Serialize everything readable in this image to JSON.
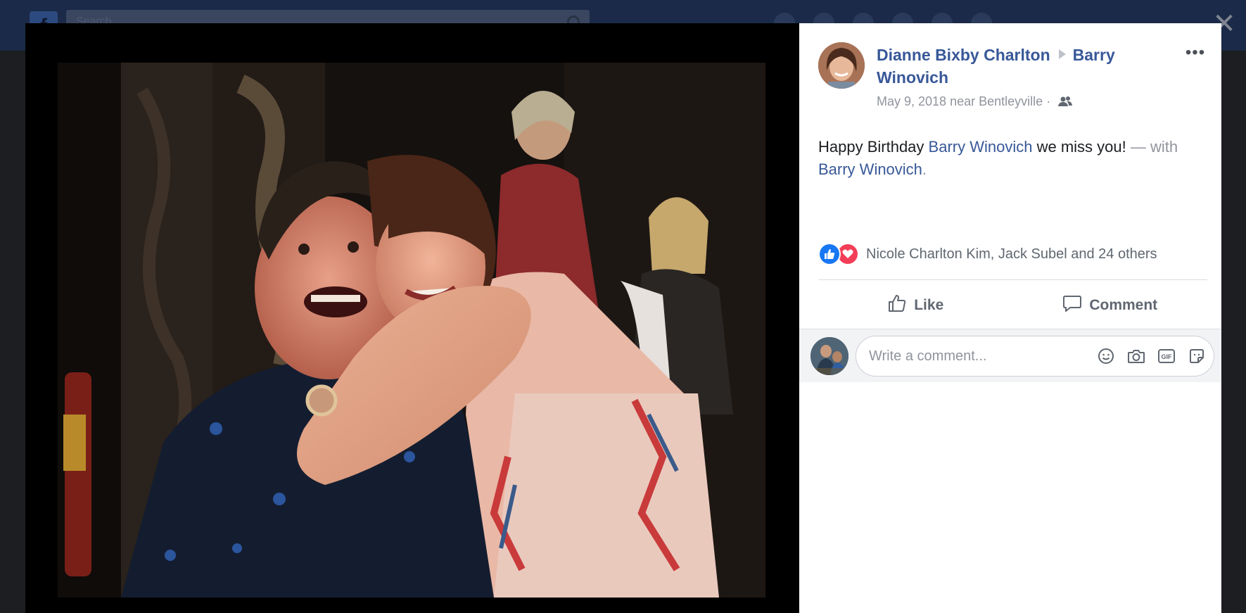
{
  "background": {
    "search_placeholder": "Search"
  },
  "post": {
    "author": "Dianne Bixby Charlton",
    "target": "Barry Winovich",
    "date": "May 9, 2018",
    "location_prefix": "near",
    "location": "Bentleyville",
    "separator": "·",
    "audience_icon": "friends-icon",
    "text_prefix": "Happy Birthday",
    "text_tag": "Barry Winovich",
    "text_suffix": "we miss you!",
    "with_label": "— with",
    "with_person": "Barry Winovich",
    "with_end": "."
  },
  "reactions": {
    "types": [
      "like",
      "love"
    ],
    "summary": "Nicole Charlton Kim, Jack Subel and 24 others"
  },
  "actions": {
    "like_label": "Like",
    "comment_label": "Comment"
  },
  "comment": {
    "placeholder": "Write a comment...",
    "icons": [
      "emoji-icon",
      "camera-icon",
      "gif-icon",
      "sticker-icon"
    ]
  },
  "colors": {
    "link": "#385898",
    "like": "#1877f2",
    "love": "#f33e58",
    "muted": "#90949c"
  }
}
